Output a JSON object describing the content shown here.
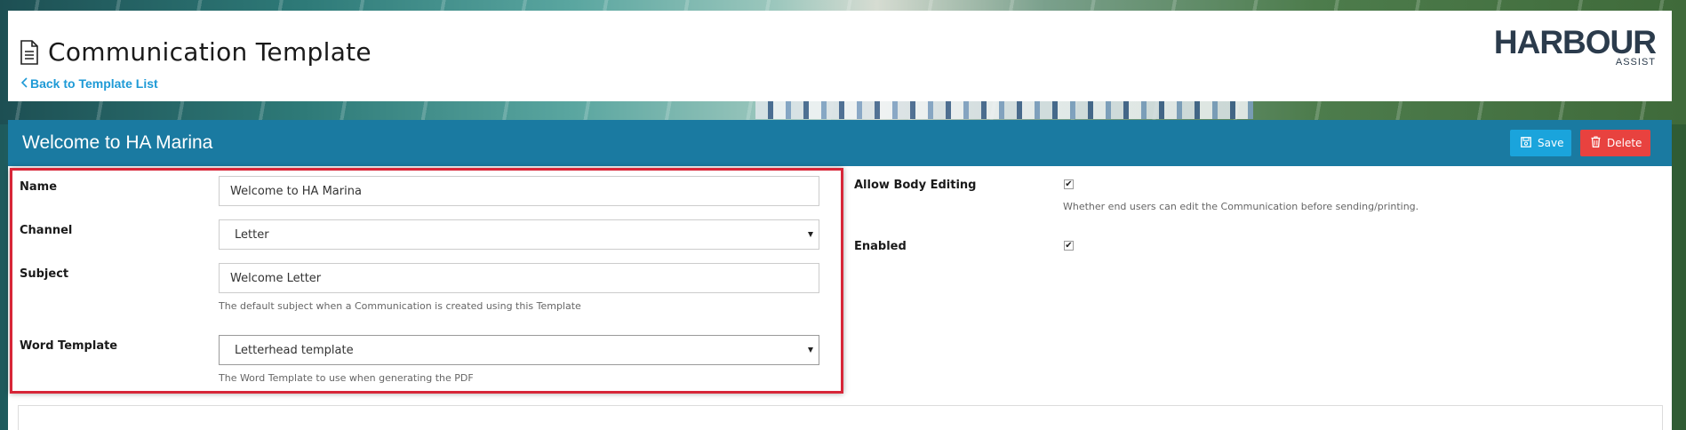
{
  "header": {
    "title": "Communication Template",
    "back_link": "Back to Template List",
    "logo_main": "HARBOUR",
    "logo_sub": "ASSIST"
  },
  "panel": {
    "title": "Welcome to HA Marina",
    "save_label": "Save",
    "delete_label": "Delete"
  },
  "form": {
    "name_label": "Name",
    "name_value": "Welcome to HA Marina",
    "channel_label": "Channel",
    "channel_value": "Letter",
    "subject_label": "Subject",
    "subject_value": "Welcome Letter",
    "subject_help": "The default subject when a Communication is created using this Template",
    "word_template_label": "Word Template",
    "word_template_value": "Letterhead template",
    "word_template_help": "The Word Template to use when generating the PDF",
    "allow_body_editing_label": "Allow Body Editing",
    "allow_body_editing_checked": true,
    "allow_body_editing_help": "Whether end users can edit the Communication before sending/printing.",
    "enabled_label": "Enabled",
    "enabled_checked": true
  },
  "colors": {
    "panel_header": "#1a7aa1",
    "save_button": "#1aa4dc",
    "delete_button": "#e8423f",
    "link": "#1e9ad6",
    "highlight": "#d72638"
  },
  "icons": {
    "title_icon": "document-icon",
    "back_icon": "chevron-left-icon",
    "save_icon": "floppy-disk-icon",
    "delete_icon": "trash-icon",
    "checkbox_icon": "check-icon"
  }
}
